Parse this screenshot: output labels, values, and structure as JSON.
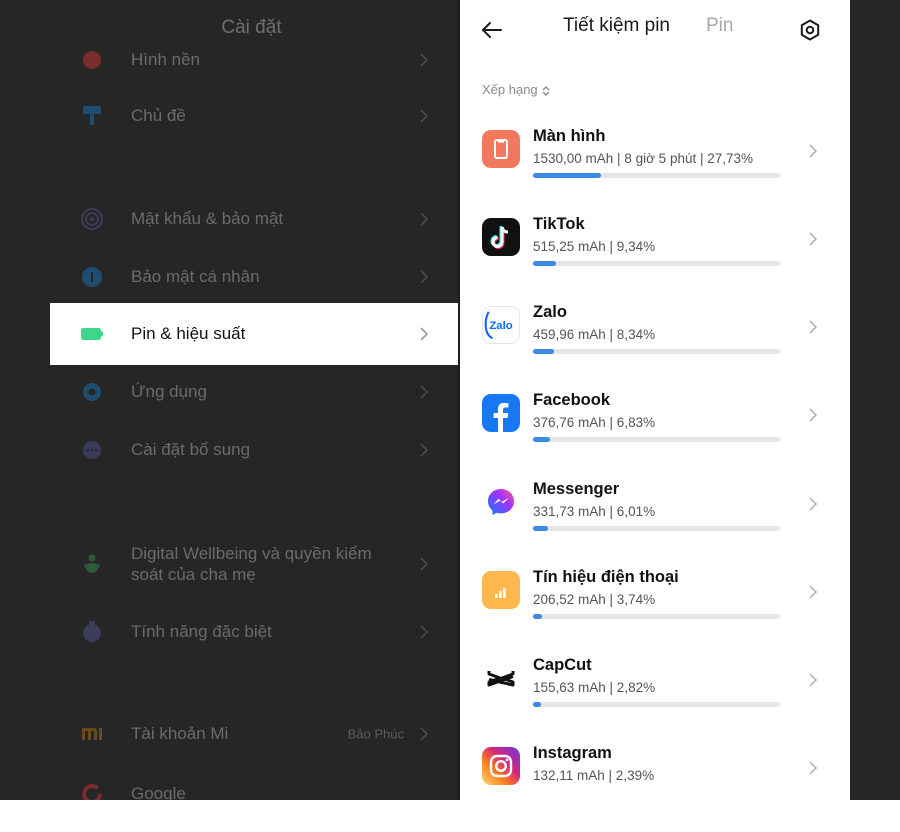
{
  "settings": {
    "title": "Cài đặt",
    "items": [
      {
        "id": "wallpaper",
        "label": "Hình nền",
        "icon": "wallpaper-icon"
      },
      {
        "id": "theme",
        "label": "Chủ đề",
        "icon": "theme-brush-icon"
      },
      {
        "id": "password",
        "label": "Mật khẩu & bảo mật",
        "icon": "fingerprint-icon"
      },
      {
        "id": "privacy",
        "label": "Bảo mật cá nhân",
        "icon": "privacy-icon"
      },
      {
        "id": "battery",
        "label": "Pin & hiệu suất",
        "icon": "battery-icon"
      },
      {
        "id": "apps",
        "label": "Ứng dụng",
        "icon": "apps-gear-icon"
      },
      {
        "id": "additional",
        "label": "Cài đặt bổ sung",
        "icon": "additional-settings-icon"
      },
      {
        "id": "wellbeing",
        "label": "Digital Wellbeing và quyền kiểm",
        "label2": "soát của cha mẹ",
        "icon": "wellbeing-icon"
      },
      {
        "id": "special",
        "label": "Tính năng đặc biệt",
        "icon": "special-features-icon"
      },
      {
        "id": "account",
        "label": "Tài khoản Mi",
        "value": "Bảo Phúc",
        "icon": "mi-logo-icon"
      },
      {
        "id": "google",
        "label": "Google",
        "icon": "google-icon"
      }
    ]
  },
  "battery": {
    "tabs": [
      "Tiết kiệm pin",
      "Pin"
    ],
    "sort_label": "Xếp hạng",
    "accent": "#3b8be6",
    "apps": [
      {
        "name": "Màn hình",
        "usage": "1530,00 mAh | 8 giờ 5 phút  | 27,73%",
        "percent": 27.73,
        "icon": "screen-icon"
      },
      {
        "name": "TikTok",
        "usage": "515,25 mAh | 9,34%",
        "percent": 9.34,
        "icon": "tiktok-icon"
      },
      {
        "name": "Zalo",
        "usage": "459,96 mAh | 8,34%",
        "percent": 8.34,
        "icon": "zalo-icon",
        "icon_text": "Zalo"
      },
      {
        "name": "Facebook",
        "usage": "376,76 mAh | 6,83%",
        "percent": 6.83,
        "icon": "facebook-icon"
      },
      {
        "name": "Messenger",
        "usage": "331,73 mAh | 6,01%",
        "percent": 6.01,
        "icon": "messenger-icon"
      },
      {
        "name": "Tín hiệu điện thoại",
        "usage": "206,52 mAh | 3,74%",
        "percent": 3.74,
        "icon": "cell-signal-icon"
      },
      {
        "name": "CapCut",
        "usage": "155,63 mAh | 2,82%",
        "percent": 2.82,
        "icon": "capcut-icon"
      },
      {
        "name": "Instagram",
        "usage": "132,11 mAh | 2,39%",
        "percent": 2.39,
        "icon": "instagram-icon"
      }
    ]
  }
}
